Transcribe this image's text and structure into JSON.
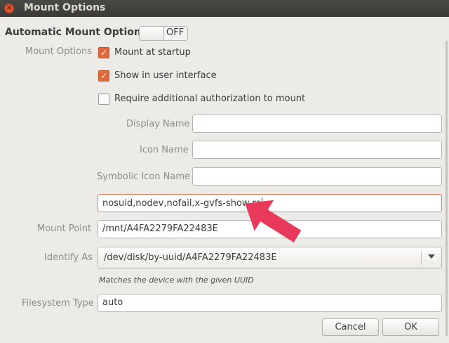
{
  "window": {
    "title": "Mount Options",
    "close_glyph": "×"
  },
  "auto": {
    "label": "Automatic Mount Options",
    "toggle_state": "OFF"
  },
  "mount_options": {
    "section_label": "Mount Options",
    "startup_label": "Mount at startup",
    "ui_label": "Show in user interface",
    "auth_label": "Require additional authorization to mount",
    "startup_checked": true,
    "ui_checked": true,
    "auth_checked": false
  },
  "fields": {
    "display_name_label": "Display Name",
    "display_name_value": "",
    "icon_name_label": "Icon Name",
    "icon_name_value": "",
    "symbolic_icon_label": "Symbolic Icon Name",
    "symbolic_icon_value": "",
    "options_value": "nosuid,nodev,nofail,x-gvfs-show,ro",
    "mount_point_label": "Mount Point",
    "mount_point_value": "/mnt/A4FA2279FA22483E",
    "identify_as_label": "Identify As",
    "identify_as_value": "/dev/disk/by-uuid/A4FA2279FA22483E",
    "identify_hint": "Matches the device with the given UUID",
    "fs_type_label": "Filesystem Type",
    "fs_type_value": "auto"
  },
  "buttons": {
    "cancel": "Cancel",
    "ok": "OK"
  },
  "colors": {
    "accent": "#e06a3c",
    "pointer": "#e8395a",
    "titlebar": "#3f3e3b"
  }
}
